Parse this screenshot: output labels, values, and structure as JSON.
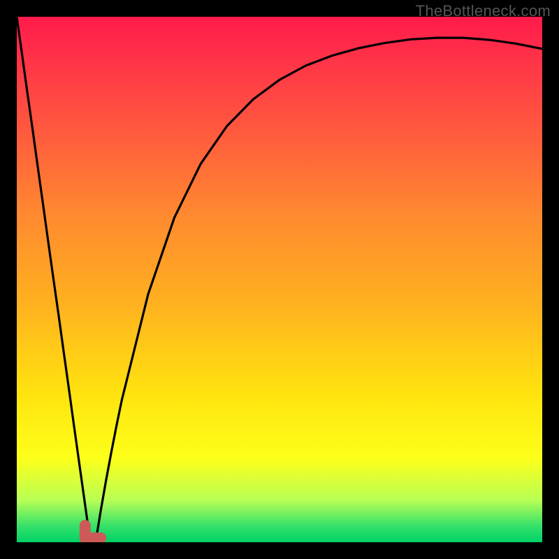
{
  "watermark": "TheBottleneck.com",
  "colors": {
    "frame_bg": "#000000",
    "gradient_top": "#ff1a4b",
    "gradient_bottom": "#00d267",
    "curve_stroke": "#000000",
    "nub_stroke": "#cc5a58"
  },
  "chart_data": {
    "type": "line",
    "title": "",
    "xlabel": "",
    "ylabel": "",
    "xlim": [
      0,
      100
    ],
    "ylim": [
      0,
      100
    ],
    "x": [
      0,
      1,
      2,
      3,
      4,
      5,
      6,
      7,
      8,
      9,
      10,
      11,
      12,
      13,
      14,
      15,
      16,
      17,
      18,
      19,
      20,
      25,
      30,
      35,
      40,
      45,
      50,
      55,
      60,
      65,
      70,
      75,
      80,
      85,
      90,
      95,
      100
    ],
    "series": [
      {
        "name": "bottleneck-curve",
        "values": [
          100,
          92.9,
          85.7,
          78.6,
          71.4,
          64.3,
          57.1,
          50.0,
          42.9,
          35.7,
          28.6,
          21.4,
          14.3,
          7.1,
          0.0,
          0.0,
          6.1,
          11.8,
          17.2,
          22.3,
          27.1,
          47.2,
          61.8,
          72.0,
          79.2,
          84.3,
          88.0,
          90.7,
          92.6,
          94.0,
          95.0,
          95.7,
          96.0,
          96.0,
          95.6,
          94.9,
          93.9
        ]
      }
    ],
    "marker": {
      "name": "optimal-point",
      "x_range": [
        13,
        16
      ],
      "y": 0
    },
    "grid": false,
    "legend": false
  }
}
